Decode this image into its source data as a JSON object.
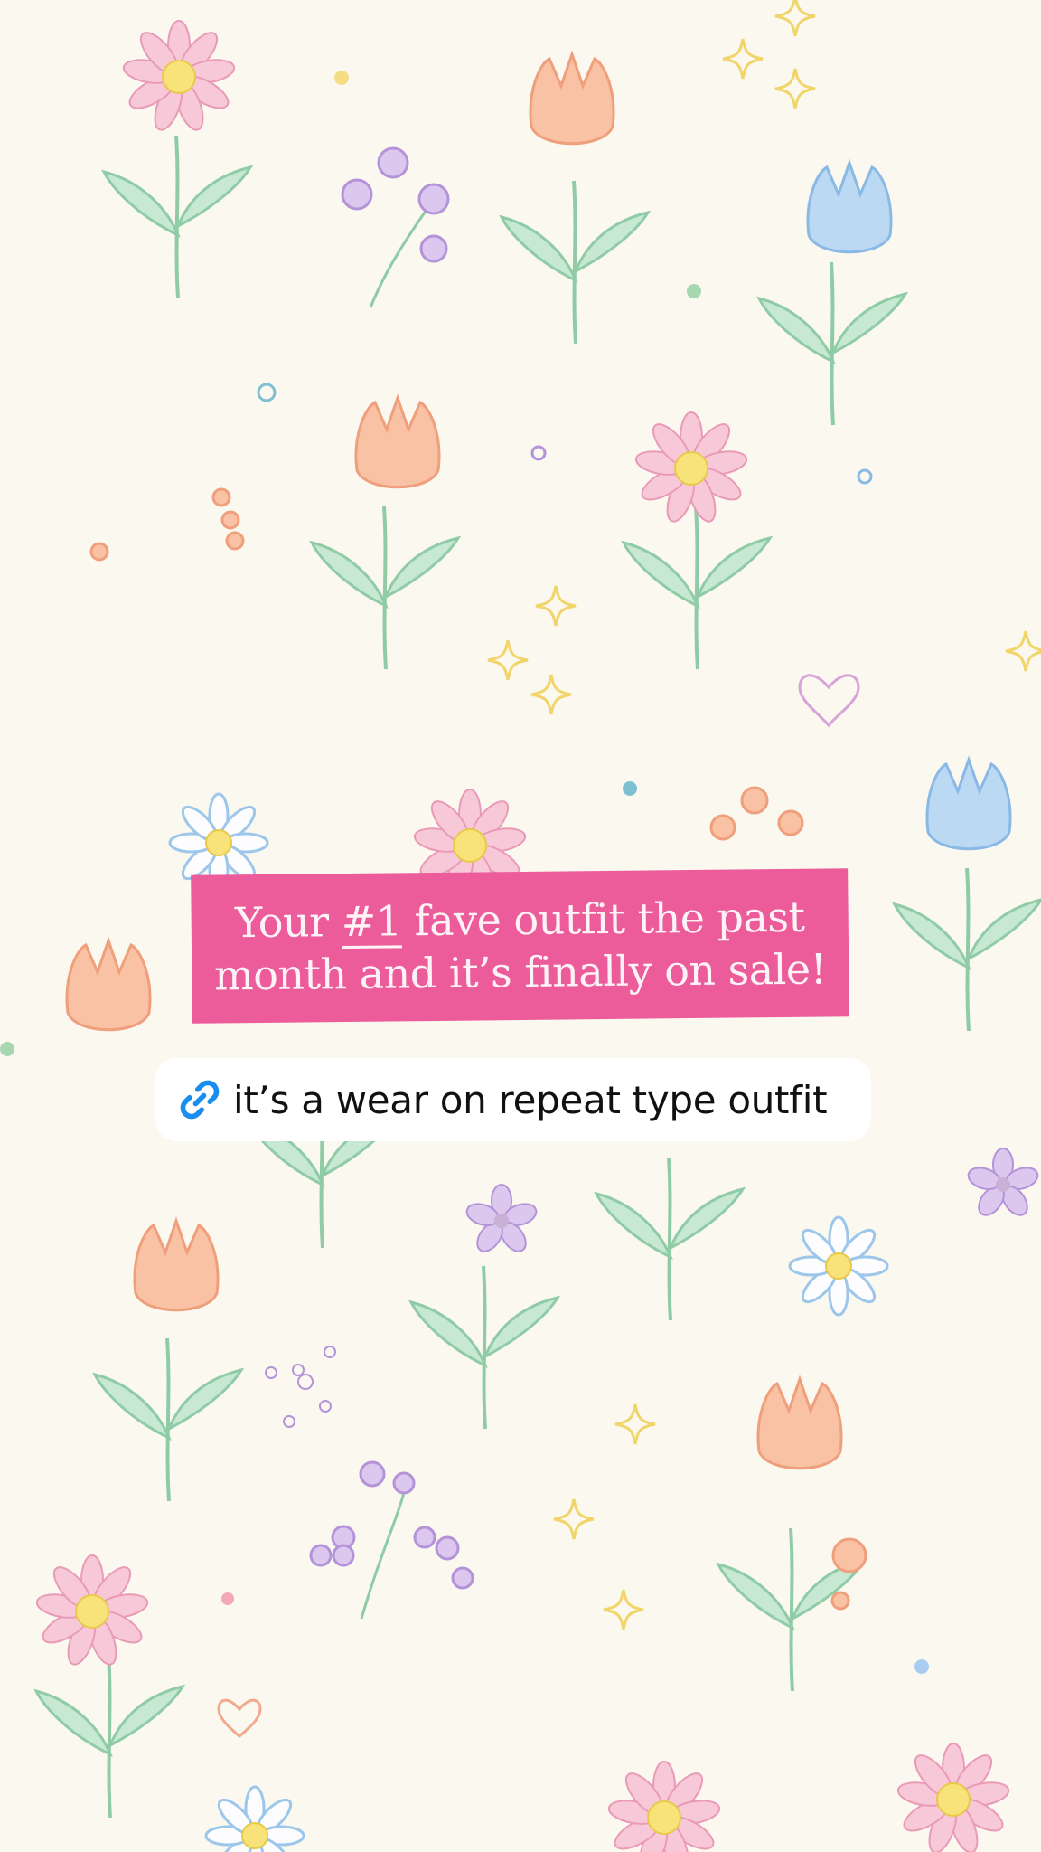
{
  "story": {
    "caption_part1": "Your ",
    "caption_hashtag": "#1",
    "caption_part2": " fave outfit the past",
    "caption_line2": "month and it’s finally on sale!",
    "link_sticker_text": "it’s a wear on repeat type outfit",
    "link_icon": "link-icon"
  },
  "background": {
    "pattern": "pastel hand-drawn flowers",
    "color": "#fbf8f0"
  },
  "colors": {
    "caption_background": "#ec5b9a",
    "caption_text": "#fdf3f6",
    "link_icon": "#1a8ef0"
  }
}
